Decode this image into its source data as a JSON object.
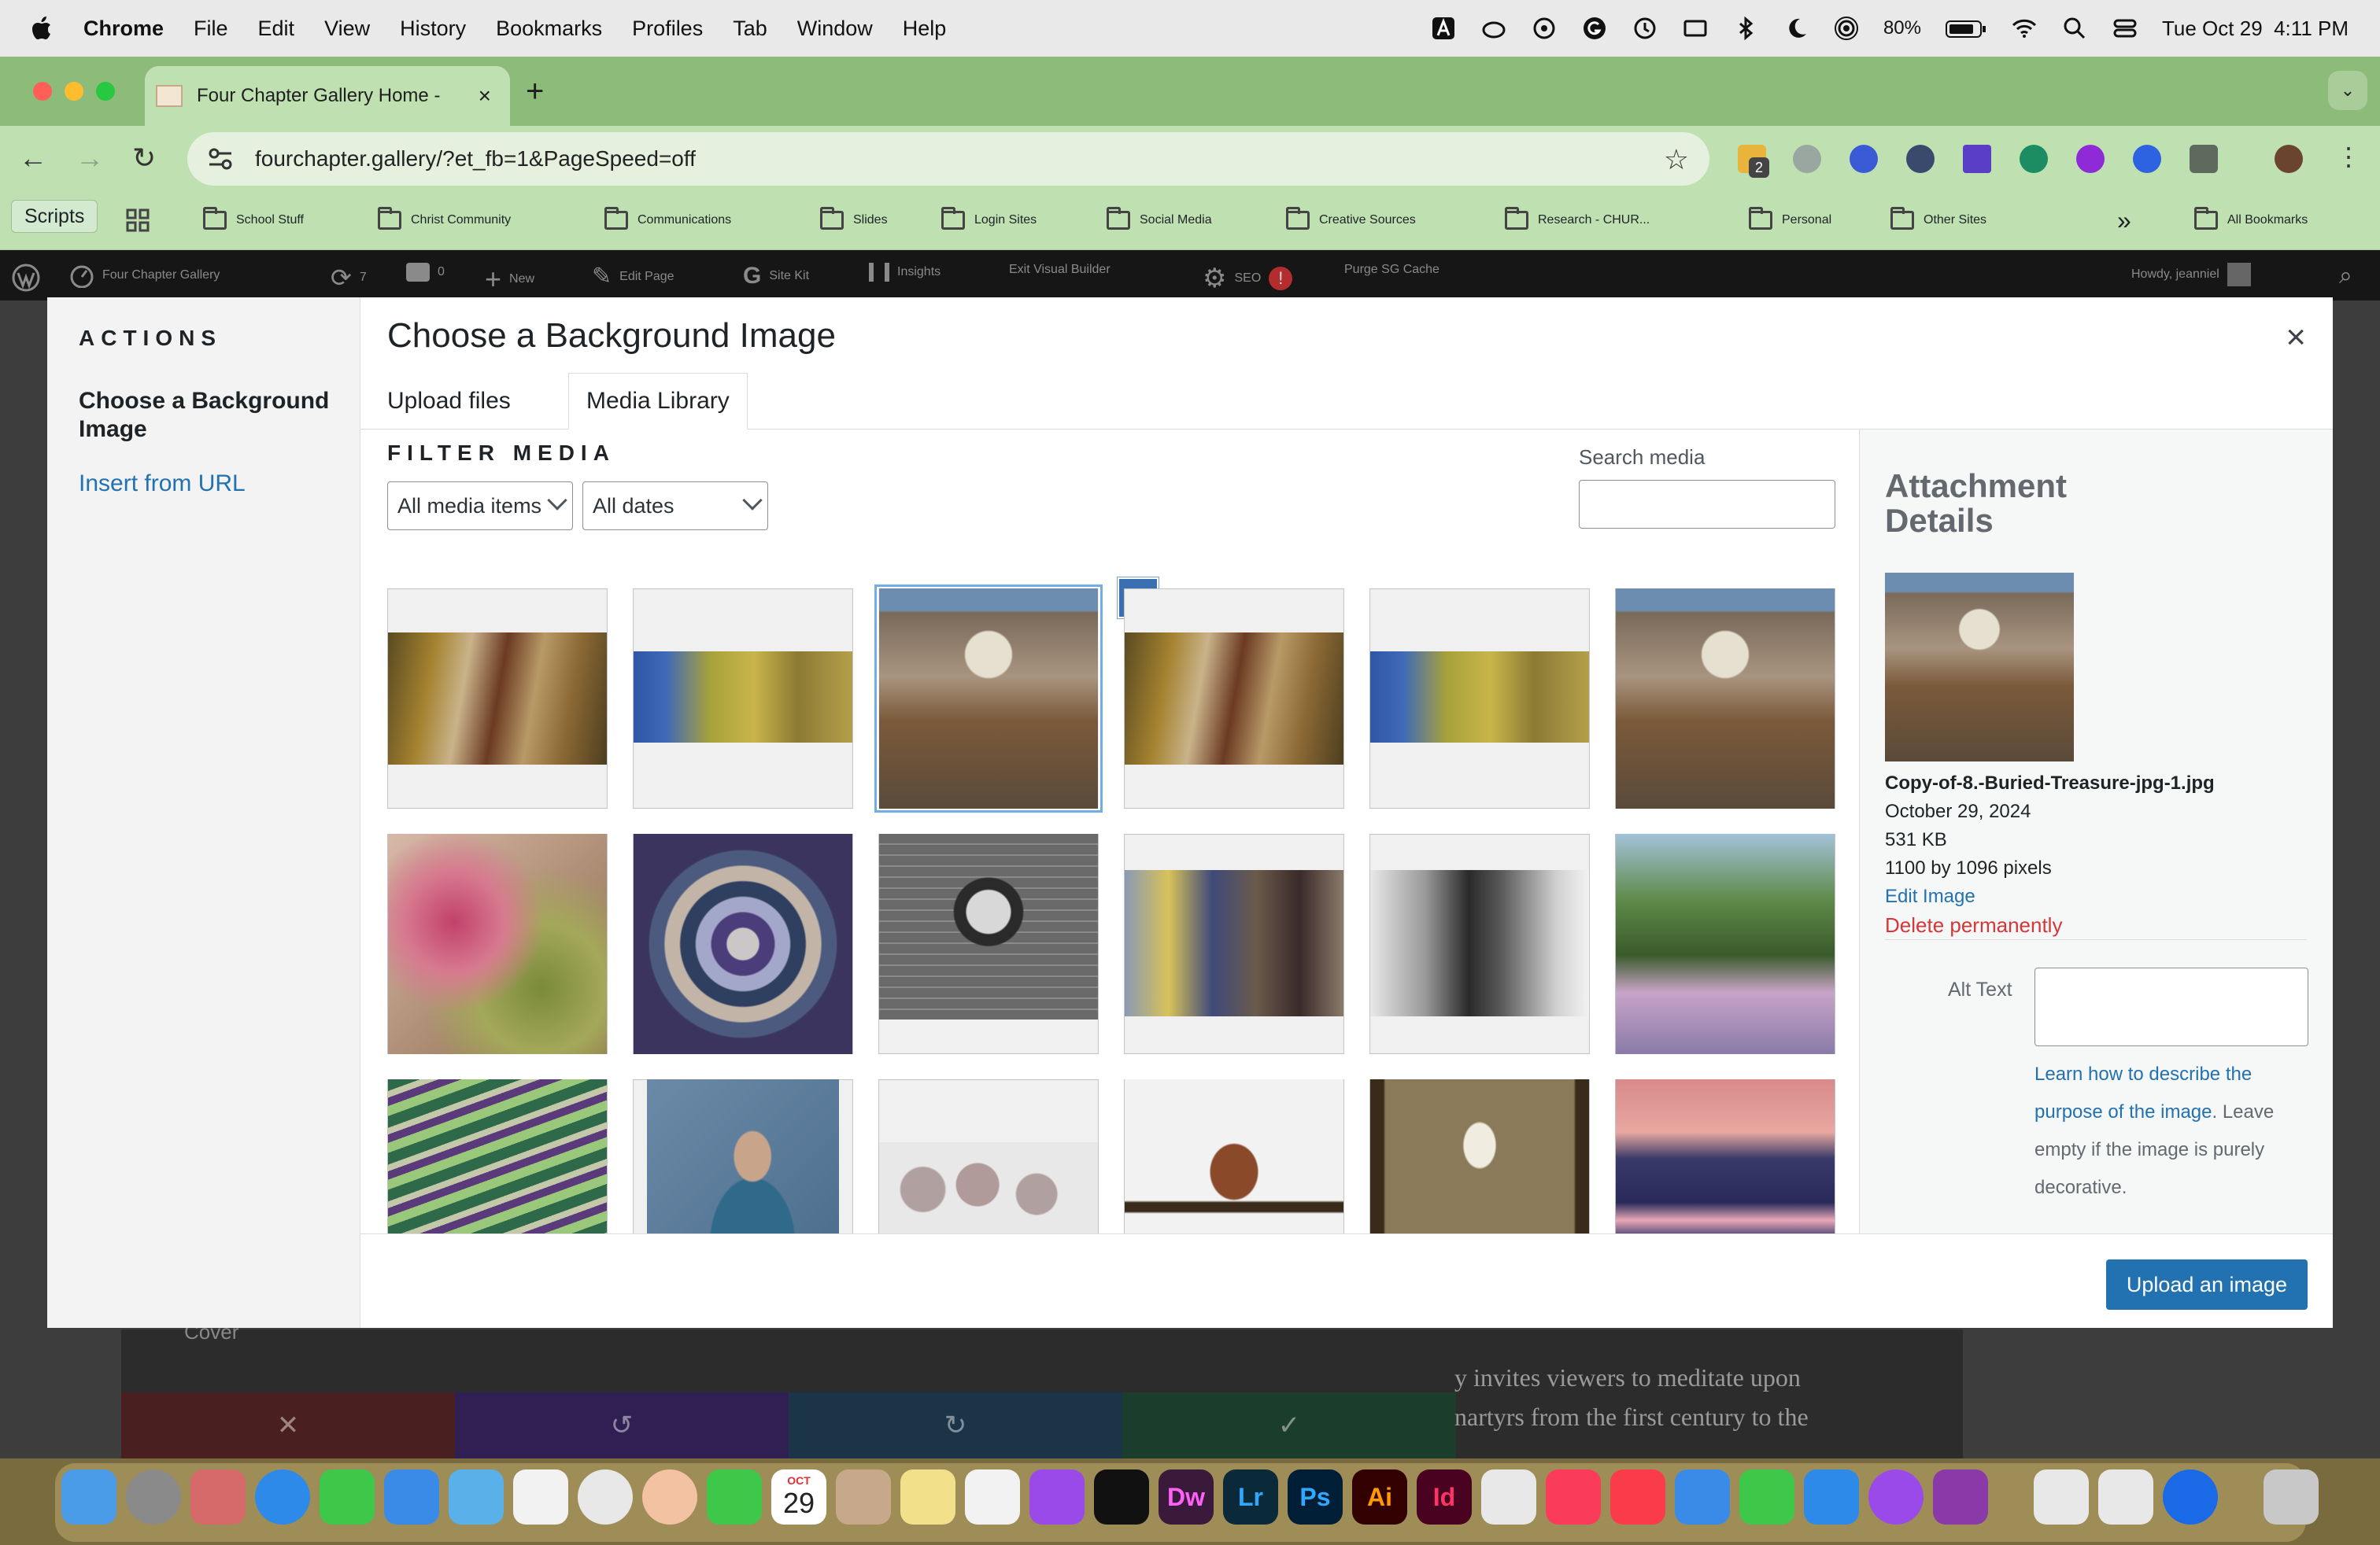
{
  "menubar": {
    "app": "Chrome",
    "items": [
      "File",
      "Edit",
      "View",
      "History",
      "Bookmarks",
      "Profiles",
      "Tab",
      "Window",
      "Help"
    ],
    "battery": "80%",
    "datetime": "Tue Oct 29  4:11 PM"
  },
  "browser": {
    "tab_title": "Four Chapter Gallery Home -",
    "url": "fourchapter.gallery/?et_fb=1&PageSpeed=off",
    "extension_badge": "2",
    "bookmarks": [
      "School Stuff",
      "Christ Community",
      "Communications",
      "Slides",
      "Login Sites",
      "Social Media",
      "Creative Sources",
      "Research - CHUR...",
      "Personal",
      "Other Sites"
    ],
    "scripts_label": "Scripts",
    "all_bookmarks": "All Bookmarks",
    "overflow": "»"
  },
  "wpbar": {
    "site": "Four Chapter Gallery",
    "updates": "7",
    "comments": "0",
    "new": "New",
    "edit_page": "Edit Page",
    "site_kit": "Site Kit",
    "insights": "Insights",
    "exit_builder": "Exit Visual Builder",
    "seo": "SEO",
    "purge": "Purge SG Cache",
    "howdy": "Howdy, jeanniel"
  },
  "modal": {
    "actions_title": "ACTIONS",
    "menu_choose": "Choose a Background Image",
    "menu_url": "Insert from URL",
    "title": "Choose a Background Image",
    "close": "×",
    "tabs": [
      "Upload files",
      "Media Library"
    ],
    "filter_title": "FILTER MEDIA",
    "filter_type": "All media items",
    "filter_date": "All dates",
    "search_label": "Search media",
    "upload_button": "Upload an image"
  },
  "details": {
    "title": "Attachment Details",
    "filename": "Copy-of-8.-Buried-Treasure-jpg-1.jpg",
    "date": "October 29, 2024",
    "size": "531 KB",
    "dimensions": "1100 by 1096 pixels",
    "edit": "Edit Image",
    "delete": "Delete permanently",
    "alt_label": "Alt Text",
    "alt_help_link": "Learn how to describe the purpose of the image",
    "alt_help_rest": ". Leave empty if the image is purely decorative."
  },
  "behind": {
    "cover": "Cover",
    "text_line1": "y invites viewers to meditate upon",
    "text_line2": "nartyrs from the first century to the"
  },
  "dock": {
    "calendar_month": "OCT",
    "calendar_day": "29",
    "dw": "Dw",
    "lr": "Lr",
    "ps": "Ps",
    "ai": "Ai",
    "id": "Id"
  }
}
